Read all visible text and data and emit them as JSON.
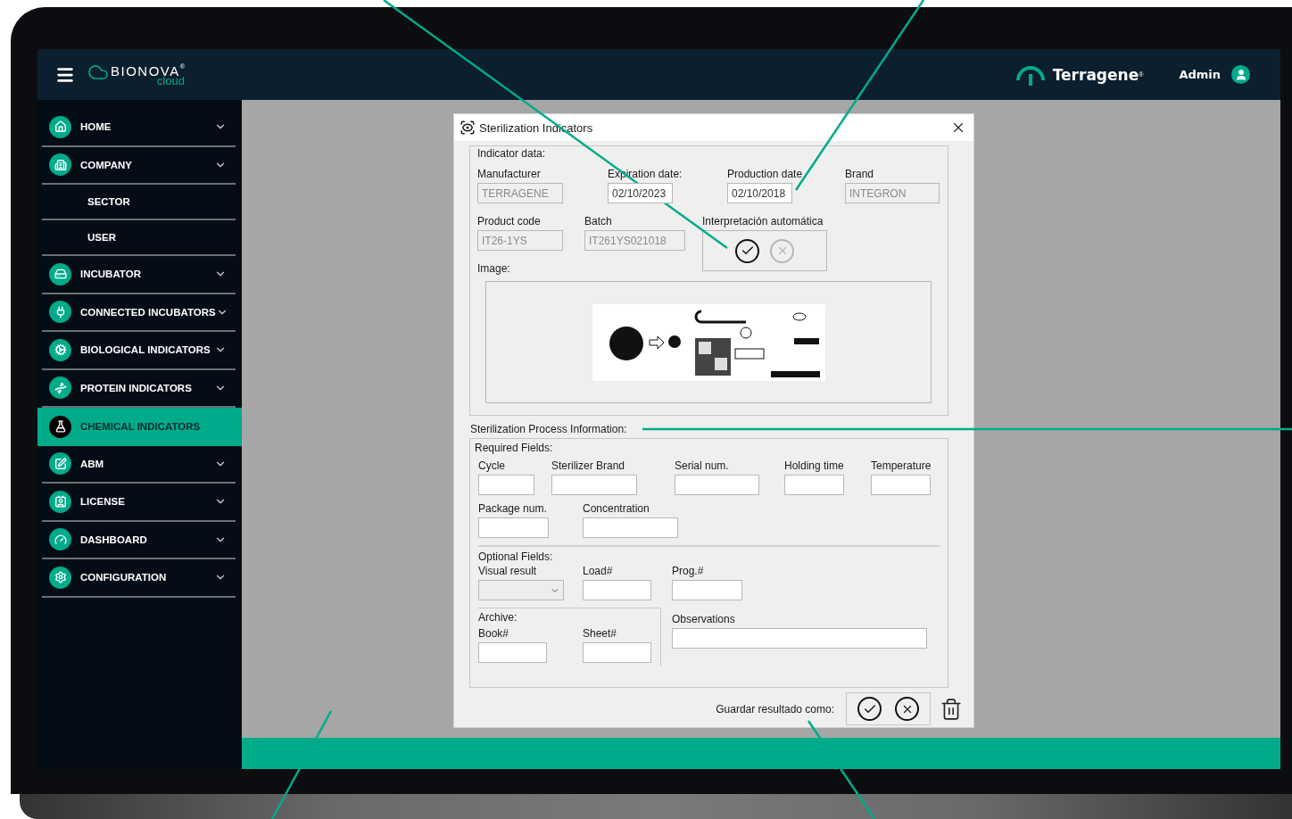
{
  "header": {
    "brand": "BIONOVA",
    "brand_mark": "®",
    "brand_sub": "cloud",
    "company": "Terragene",
    "company_mark": "®",
    "user": "Admin"
  },
  "sidebar": {
    "items": [
      {
        "label": "HOME",
        "kind": "section",
        "selected": false,
        "expandable": true
      },
      {
        "label": "COMPANY",
        "kind": "section",
        "selected": false,
        "expandable": true
      },
      {
        "label": "SECTOR",
        "kind": "sub",
        "selected": false
      },
      {
        "label": "USER",
        "kind": "sub",
        "selected": false
      },
      {
        "label": "INCUBATOR",
        "kind": "section",
        "selected": false,
        "expandable": true
      },
      {
        "label": "CONNECTED INCUBATORS",
        "kind": "section",
        "selected": false,
        "expandable": true
      },
      {
        "label": "BIOLOGICAL INDICATORS",
        "kind": "section",
        "selected": false,
        "expandable": true
      },
      {
        "label": "PROTEIN INDICATORS",
        "kind": "section",
        "selected": false,
        "expandable": true
      },
      {
        "label": "CHEMICAL INDICATORS",
        "kind": "section",
        "selected": true,
        "expandable": false
      },
      {
        "label": "ABM",
        "kind": "section",
        "selected": false,
        "expandable": true
      },
      {
        "label": "LICENSE",
        "kind": "section",
        "selected": false,
        "expandable": true
      },
      {
        "label": "DASHBOARD",
        "kind": "section",
        "selected": false,
        "expandable": true
      },
      {
        "label": "CONFIGURATION",
        "kind": "section",
        "selected": false,
        "expandable": true
      }
    ]
  },
  "dialog": {
    "title": "Sterilization Indicators",
    "indicator_data": {
      "title": "Indicator data:",
      "fields": [
        {
          "label": "Manufacturer",
          "value": "TERRAGENE",
          "disabled": true
        },
        {
          "label": "Expiration date:",
          "value": "02/10/2023",
          "disabled": false
        },
        {
          "label": "Production date",
          "value": "02/10/2018",
          "disabled": false
        },
        {
          "label": "Brand",
          "value": "INTEGRON",
          "disabled": true
        },
        {
          "label": "Product code",
          "value": "IT26-1YS",
          "disabled": true
        },
        {
          "label": "Batch",
          "value": "IT261YS021018",
          "disabled": true
        }
      ],
      "auto_interpretation": {
        "label": "Interpretación automática",
        "options": [
          {
            "kind": "accept",
            "selected": true
          },
          {
            "kind": "reject",
            "selected": false
          }
        ]
      },
      "image_label": "Image:"
    },
    "process": {
      "title": "Sterilization Process Information:",
      "required_title": "Required Fields:",
      "required_fields": [
        {
          "label": "Cycle"
        },
        {
          "label": "Sterilizer Brand"
        },
        {
          "label": "Serial num."
        },
        {
          "label": "Holding time"
        },
        {
          "label": "Temperature"
        },
        {
          "label": "Package num."
        },
        {
          "label": "Concentration"
        }
      ],
      "optional_title": "Optional Fields:",
      "optional_fields": [
        {
          "label": "Visual result",
          "kind": "select"
        },
        {
          "label": "Load#",
          "kind": "text"
        },
        {
          "label": "Prog.#",
          "kind": "text"
        }
      ],
      "archive": {
        "title": "Archive:",
        "fields": [
          {
            "label": "Book#"
          },
          {
            "label": "Sheet#"
          }
        ]
      },
      "observations": {
        "label": "Observations"
      }
    },
    "save": {
      "label": "Guardar resultado como:"
    }
  }
}
